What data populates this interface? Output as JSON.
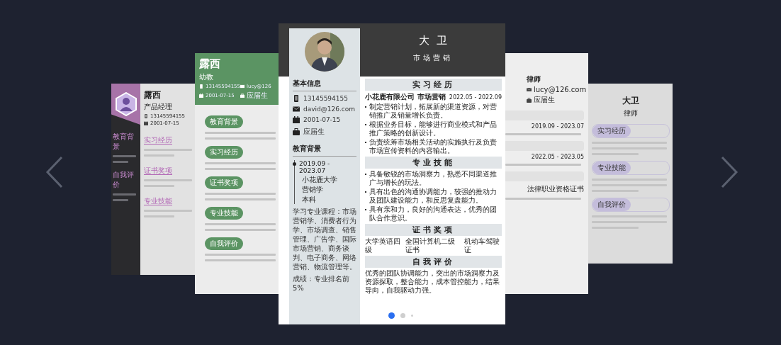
{
  "carousel": {
    "slides": [
      {
        "kind": "sidebar-dark",
        "name": "露西",
        "title": "产品经理",
        "contacts": [
          {
            "kind": "phone",
            "text": "13145594155"
          },
          {
            "kind": "calendar",
            "text": "2001-07-15"
          }
        ],
        "side_sections": [
          {
            "title": "教育背景"
          },
          {
            "title": "自我评价"
          }
        ],
        "sections": [
          {
            "title": "实习经历"
          },
          {
            "title": "证书奖项"
          },
          {
            "title": "专业技能"
          }
        ]
      },
      {
        "kind": "green-header",
        "name": "露西",
        "title": "幼教",
        "contacts": [
          {
            "kind": "phone",
            "text": "13145594155"
          },
          {
            "kind": "mail",
            "text": "lucy@126"
          },
          {
            "kind": "calendar",
            "text": "2001-07-15"
          },
          {
            "kind": "person",
            "text": "应届生"
          }
        ],
        "sections": [
          {
            "title": "教育背景"
          },
          {
            "title": "实习经历"
          },
          {
            "title": "证书奖项"
          },
          {
            "title": "专业技能"
          },
          {
            "title": "自我评价"
          }
        ]
      },
      {
        "kind": "classic",
        "name": "大卫",
        "title": "市场营销",
        "basic_title": "基本信息",
        "contacts": [
          {
            "kind": "phone",
            "text": "13145594155"
          },
          {
            "kind": "mail",
            "text": "david@126.com"
          },
          {
            "kind": "calendar",
            "text": "2001-07-15"
          },
          {
            "kind": "person",
            "text": "应届生"
          }
        ],
        "education": {
          "title": "教育背景",
          "period": "2019.09 - 2023.07",
          "items": [
            "小花鹿大学",
            "营销学",
            "本科"
          ],
          "courses": "学习专业课程：市场营销学、消费者行为学、市场调查、销售管理、广告学、国际市场营销、商务谈判、电子商务、网络营销、物流管理等。",
          "score": "成绩：专业排名前5%"
        },
        "sections": [
          {
            "kind": "job",
            "title": "实习经历",
            "company": "小花鹿有限公司",
            "role": "市场营销",
            "period": "2022.05 - 2022.09",
            "bullets": [
              "制定营销计划，拓展新的渠道资源，对营销推广及销量增长负责。",
              "根据业务目标，能够进行商业模式和产品推广策略的创新设计。",
              "负责统筹市场相关活动的实施执行及负责市场宣传资料的内容输出。"
            ]
          },
          {
            "kind": "bullets",
            "title": "专业技能",
            "bullets": [
              "具备敏锐的市场洞察力，熟悉不同渠道推广与增长的玩法。",
              "具有出色的沟通协调能力，较强的推动力及团队建设能力，和反思复盘能力。",
              "具有亲和力，良好的沟通表达，优秀的团队合作意识。"
            ]
          },
          {
            "kind": "row",
            "title": "证书奖项",
            "items": [
              "大学英语四级",
              "全国计算机二级证书",
              "机动车驾驶证"
            ]
          },
          {
            "kind": "text",
            "title": "自我评价",
            "text": "优秀的团队协调能力，突出的市场洞察力及资源探取，整合能力，成本管控能力，结果导向，自我驱动力强。"
          }
        ]
      },
      {
        "kind": "plain-light",
        "title": "律师",
        "contacts": [
          {
            "kind": "mail",
            "text": "lucy@126.com"
          },
          {
            "kind": "person",
            "text": "应届生"
          }
        ],
        "sections": [
          {
            "date": "2019.09 - 2023.07"
          },
          {
            "date": "2022.05 - 2023.05"
          },
          {
            "line": "法律职业资格证书"
          }
        ]
      },
      {
        "kind": "lavender",
        "name": "大卫",
        "title": "律师",
        "sections": [
          {
            "title": "实习经历"
          },
          {
            "title": "专业技能"
          },
          {
            "title": "自我评价"
          }
        ]
      }
    ],
    "dots": [
      {
        "selected": true
      },
      {
        "selected": false
      },
      {
        "selected": false
      }
    ]
  }
}
